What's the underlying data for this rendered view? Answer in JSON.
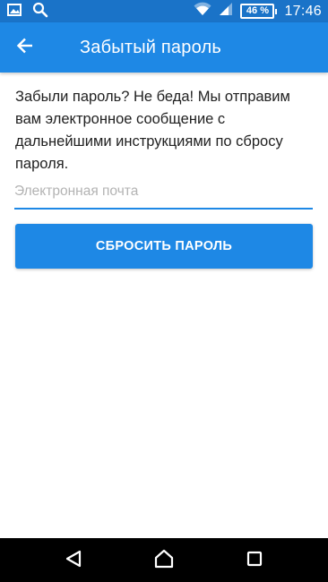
{
  "status_bar": {
    "left_icons": [
      "image-icon",
      "search-icon"
    ],
    "right_icons": [
      "wifi-icon",
      "signal-icon",
      "battery-icon"
    ],
    "battery_level": "46 %",
    "time": "17:46"
  },
  "app_bar": {
    "title": "Забытый пароль",
    "back_icon": "arrow-left-icon"
  },
  "content": {
    "message": "Забыли пароль? Не беда! Мы отправим вам электронное сообщение с дальнейшими инструкциями по сбросу пароля.",
    "email_placeholder": "Электронная почта",
    "email_value": "",
    "reset_button_label": "СБРОСИТЬ ПАРОЛЬ"
  },
  "nav_bar": {
    "icons": [
      "back-triangle-icon",
      "home-icon",
      "recents-icon"
    ]
  },
  "colors": {
    "status_bar": "#1a73c8",
    "app_bar": "#1e88e5",
    "accent": "#1e88e5",
    "text": "#212121",
    "placeholder": "#b3b3b3",
    "nav_bar": "#000000"
  }
}
